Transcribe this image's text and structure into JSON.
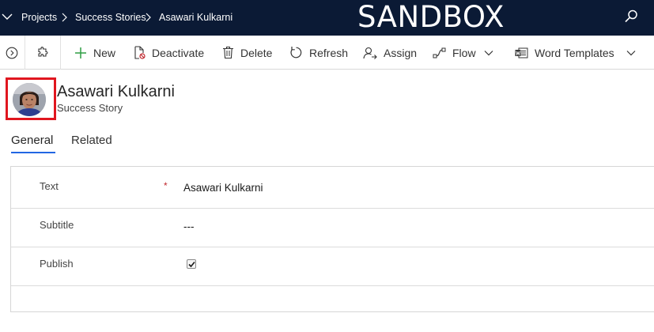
{
  "topbar": {
    "breadcrumbs": [
      "Projects",
      "Success Stories",
      "Asawari Kulkarni"
    ],
    "environment_banner": "SANDBOX",
    "nav_icon": "chevron-down-icon",
    "search_icon": "search-icon",
    "background_color": "#0b1a35"
  },
  "commandbar": {
    "expand_icon": "chevron-right-circle-icon",
    "extension_icon": "puzzle-icon",
    "new_label": "New",
    "deactivate_label": "Deactivate",
    "delete_label": "Delete",
    "refresh_label": "Refresh",
    "assign_label": "Assign",
    "flow_label": "Flow",
    "word_templates_label": "Word Templates"
  },
  "header": {
    "title": "Asawari Kulkarni",
    "entity": "Success Story",
    "highlight_color": "#e0161f"
  },
  "tabs": [
    {
      "label": "General",
      "selected": true
    },
    {
      "label": "Related",
      "selected": false
    }
  ],
  "form": {
    "fields": [
      {
        "label": "Text",
        "value": "Asawari Kulkarni",
        "required": "*"
      },
      {
        "label": "Subtitle",
        "value": "---"
      },
      {
        "label": "Publish",
        "checked": true
      }
    ]
  },
  "colors": {
    "accent": "#2266e3",
    "required": "#c0272d"
  }
}
